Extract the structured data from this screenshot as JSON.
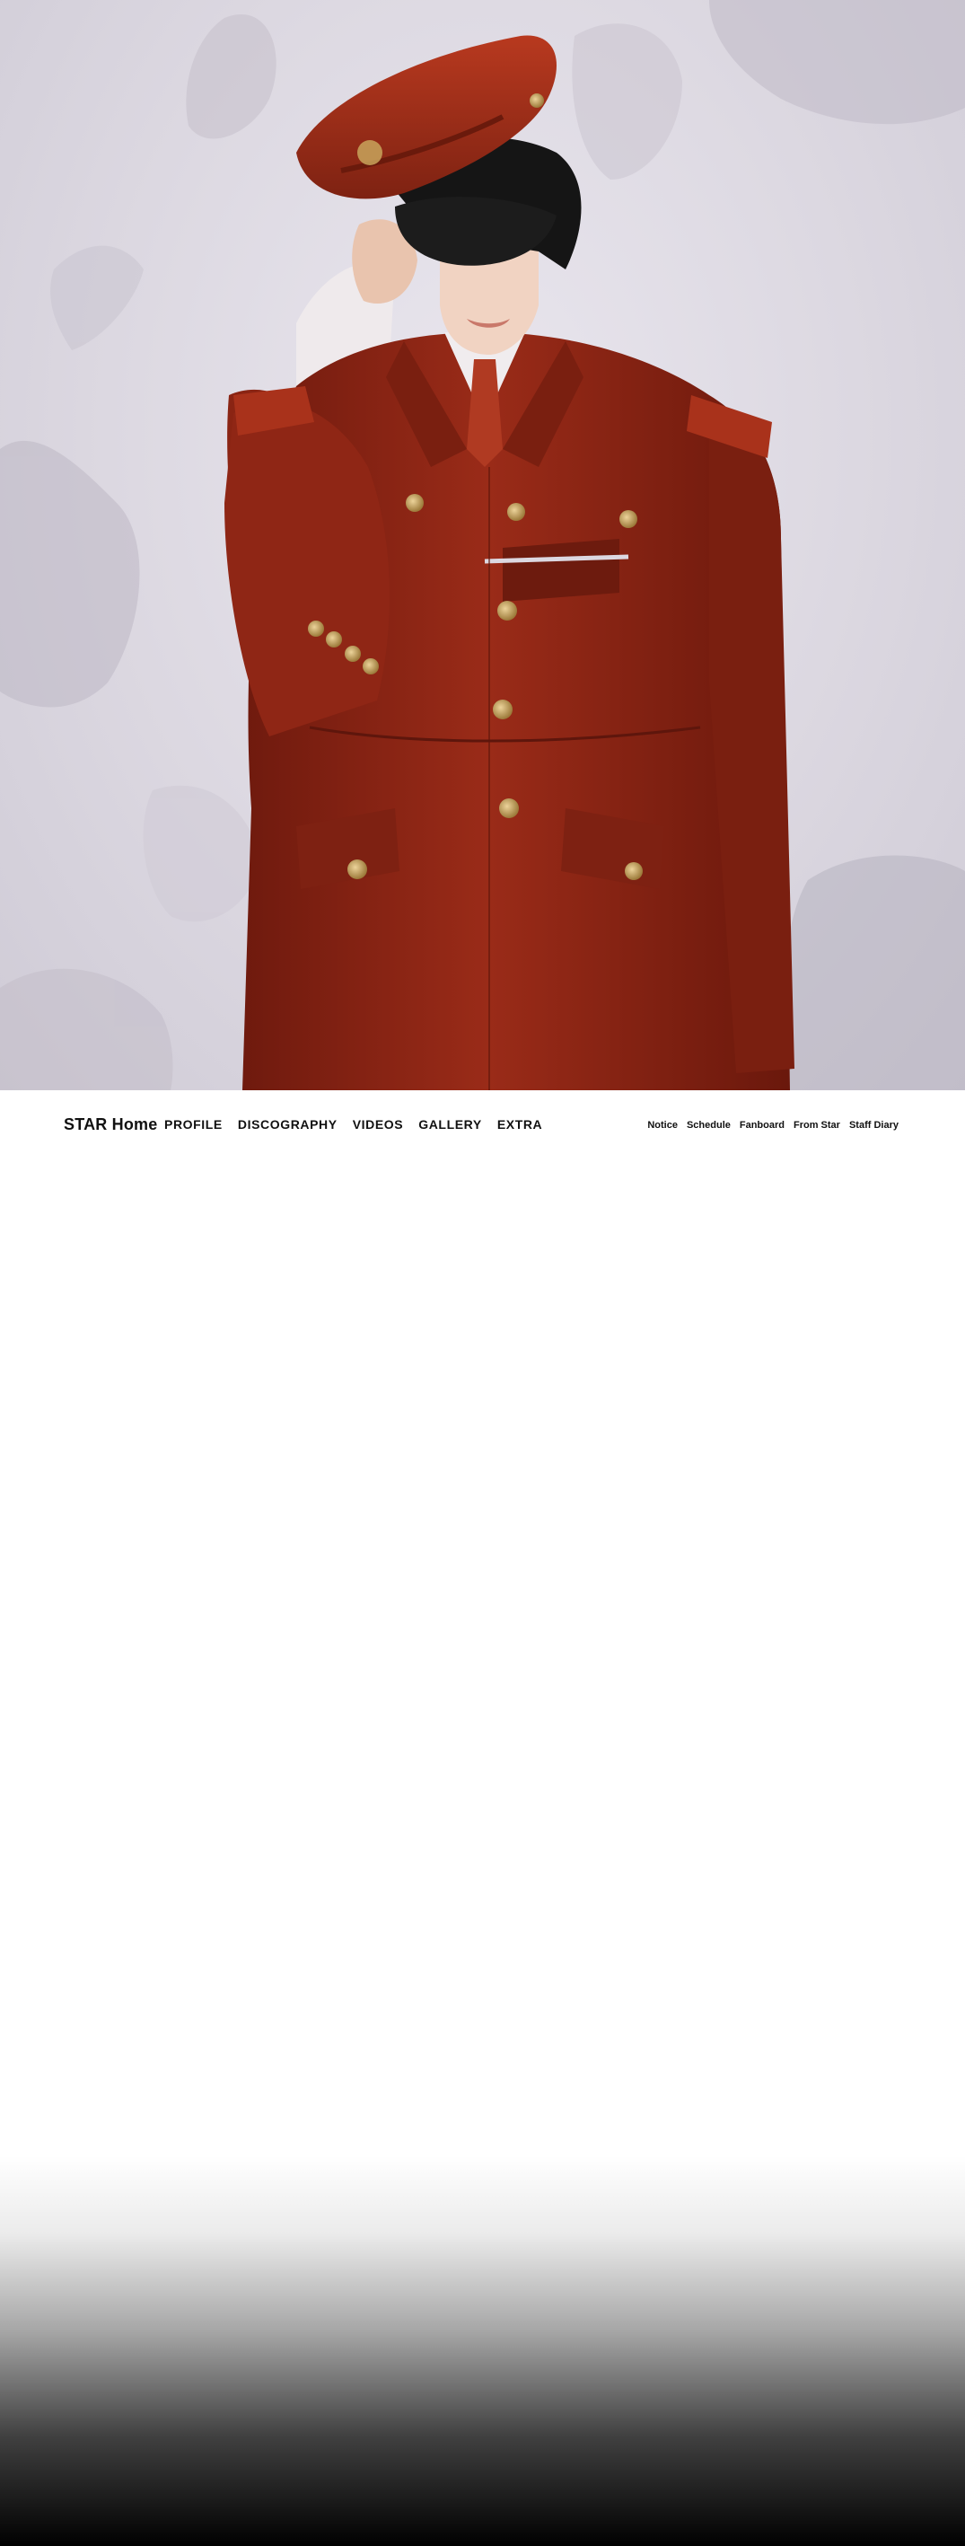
{
  "hero": {
    "image_semantic": "artist-portrait",
    "colors": {
      "background": "#dcd8e1",
      "coat": "#8c2414",
      "coat_dark": "#5e160c",
      "buttons": "#c8a45c",
      "shirt": "#f3f0f2",
      "hair": "#151515"
    }
  },
  "nav": {
    "brand": "STAR Home",
    "main_items": [
      {
        "label": "PROFILE"
      },
      {
        "label": "DISCOGRAPHY"
      },
      {
        "label": "VIDEOS"
      },
      {
        "label": "GALLERY"
      },
      {
        "label": "EXTRA"
      }
    ],
    "sub_items": [
      {
        "label": "Notice"
      },
      {
        "label": "Schedule"
      },
      {
        "label": "Fanboard"
      },
      {
        "label": "From Star"
      },
      {
        "label": "Staff Diary"
      }
    ]
  }
}
